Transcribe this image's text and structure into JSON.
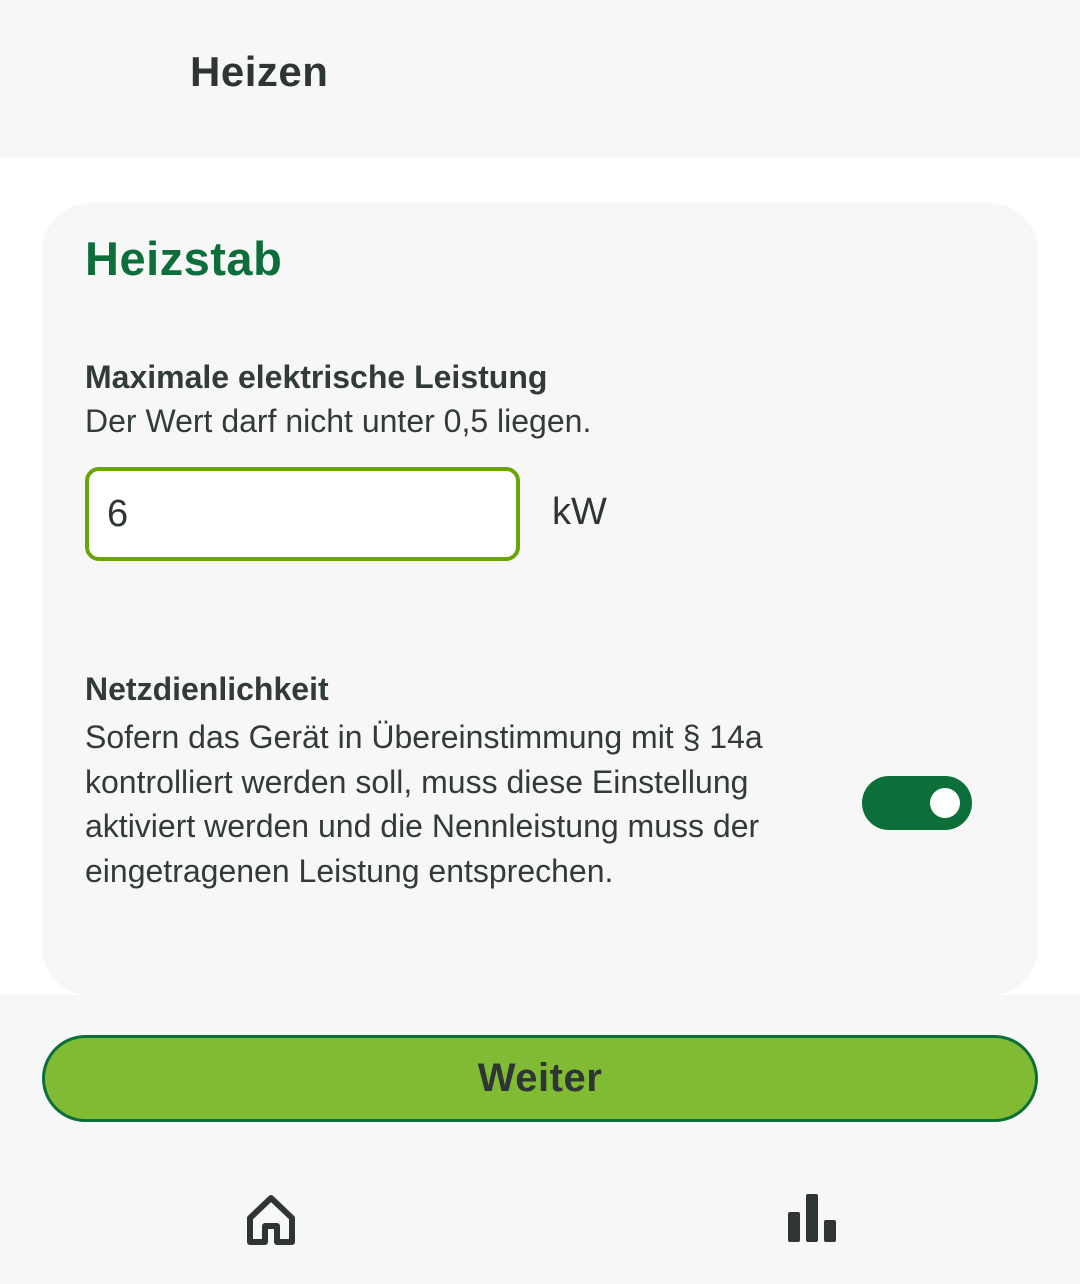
{
  "header": {
    "title": "Heizen"
  },
  "card": {
    "title": "Heizstab",
    "power": {
      "label": "Maximale elektrische Leistung",
      "hint": "Der Wert darf nicht unter 0,5 liegen.",
      "value": "6",
      "unit": "kW"
    },
    "grid": {
      "label": "Netzdienlichkeit",
      "description": "Sofern das Gerät in Übereinstimmung mit § 14a kontrolliert werden soll, muss diese Einstellung aktiviert werden und die Nennleistung muss der eingetragenen Leistung entsprechen.",
      "enabled": true
    }
  },
  "actions": {
    "next_label": "Weiter"
  },
  "bottom_nav": {
    "items": [
      {
        "icon": "home-icon"
      },
      {
        "icon": "bar-chart-icon"
      }
    ]
  },
  "colors": {
    "brand_green": "#0c6e39",
    "accent_green": "#80bb33",
    "input_border": "#6aa40a"
  }
}
